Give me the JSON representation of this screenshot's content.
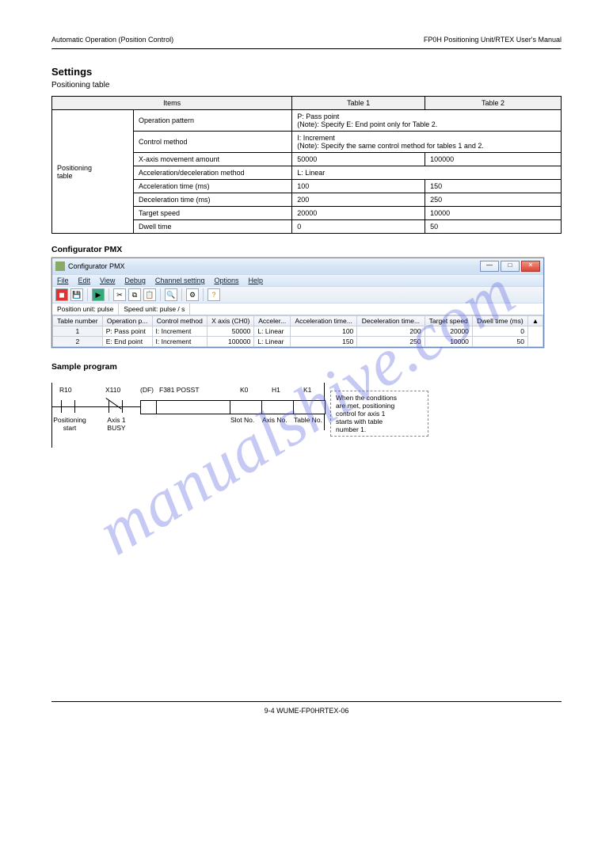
{
  "header": {
    "left": "Automatic Operation (Position Control)",
    "right": "FP0H Positioning Unit/RTEX User's Manual"
  },
  "section": {
    "title": "Settings",
    "intro": "Positioning table",
    "spec_headers": {
      "items": "Items",
      "table1": "Table 1",
      "table2": "Table 2"
    },
    "spec_rows_label": "Positioning\ntable",
    "spec_rows": [
      {
        "item": "Operation pattern",
        "desc": "P: Pass point\n(Note): Specify E: End point only for Table 2."
      },
      {
        "item": "Control method",
        "desc": "I: Increment\n(Note): Specify the same control method for tables 1 and 2."
      },
      {
        "item": "X-axis movement amount",
        "t1": "50000",
        "t2": "100000"
      },
      {
        "item": "Acceleration/deceleration method",
        "desc": "L: Linear"
      },
      {
        "item": "Acceleration time (ms)",
        "t1": "100",
        "t2": "150"
      },
      {
        "item": "Deceleration time (ms)",
        "t1": "200",
        "t2": "250"
      },
      {
        "item": "Target speed",
        "t1": "20000",
        "t2": "10000"
      },
      {
        "item": "Dwell time",
        "t1": "0",
        "t2": "50"
      }
    ]
  },
  "sub": "Configurator PMX",
  "app": {
    "title": "Configurator PMX",
    "menus": [
      "File",
      "Edit",
      "View",
      "Debug",
      "Channel setting",
      "Options",
      "Help"
    ],
    "toolbar_icons": [
      "new",
      "save",
      "",
      "cut",
      "copy",
      "paste",
      "",
      "find",
      "print",
      "",
      "cfg",
      "help"
    ],
    "units": {
      "pos": "Position unit: pulse",
      "speed": "Speed unit: pulse / s"
    },
    "grid_headers": [
      "Table number",
      "Operation p...",
      "Control method",
      "X axis (CH0)",
      "Acceler...",
      "Acceleration time...",
      "Deceleration time...",
      "Target speed",
      "Dwell time (ms)"
    ],
    "grid_rows": [
      {
        "n": "1",
        "op": "P: Pass point",
        "cm": "I: Increment",
        "x": "50000",
        "am": "L: Linear",
        "at": "100",
        "dt": "200",
        "ts": "20000",
        "dw": "0"
      },
      {
        "n": "2",
        "op": "E: End point",
        "cm": "I: Increment",
        "x": "100000",
        "am": "L: Linear",
        "at": "150",
        "dt": "250",
        "ts": "10000",
        "dw": "50"
      }
    ]
  },
  "ladder": {
    "title": "Sample program",
    "labels": {
      "r10": "R10",
      "r10_desc": "Positioning\nstart",
      "x110": "X110",
      "x110_desc": "Axis 1\nBUSY",
      "instr_name": "F381 POSST",
      "k0": "K0",
      "h1": "H1",
      "k1": "K1",
      "df_box": "When the conditions\nare met, positioning\ncontrol for axis 1\nstarts with table\nnumber 1.",
      "col_slot": "Slot No.",
      "col_axis": "Axis No.",
      "col_table": "Table No."
    }
  },
  "footer": "9-4      WUME-FP0HRTEX-06",
  "watermark": "manualshive.com"
}
